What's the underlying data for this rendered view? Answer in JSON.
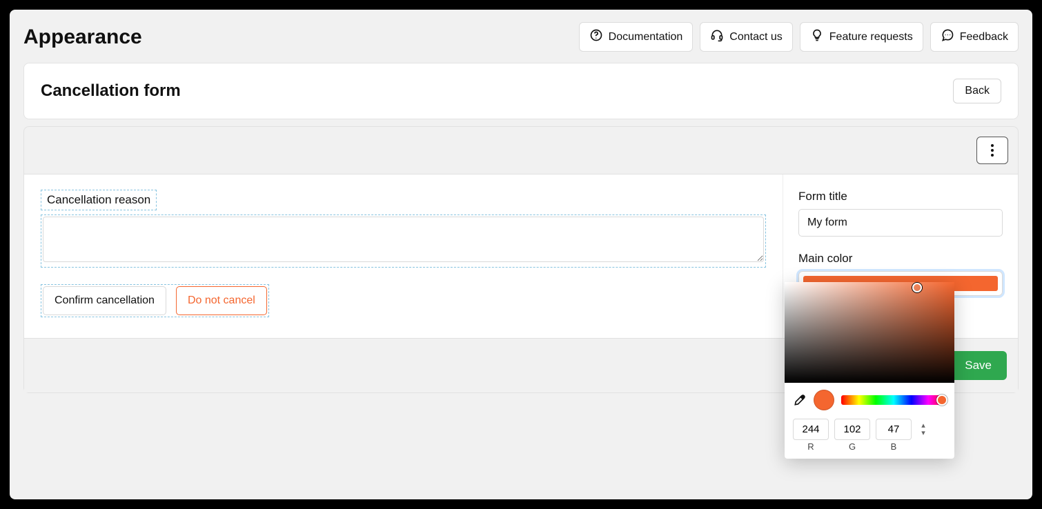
{
  "page": {
    "title": "Appearance"
  },
  "header": {
    "actions": [
      {
        "label": "Documentation",
        "icon": "help-circle-icon"
      },
      {
        "label": "Contact us",
        "icon": "headset-icon"
      },
      {
        "label": "Feature requests",
        "icon": "lightbulb-icon"
      },
      {
        "label": "Feedback",
        "icon": "chat-icon"
      }
    ]
  },
  "subheader": {
    "title": "Cancellation form",
    "back_label": "Back"
  },
  "preview": {
    "reason_label": "Cancellation reason",
    "reason_value": "",
    "confirm_label": "Confirm cancellation",
    "cancel_label": "Do not cancel"
  },
  "settings": {
    "form_title_label": "Form title",
    "form_title_value": "My form",
    "main_color_label": "Main color",
    "main_color_hex": "#f4662f"
  },
  "color_picker": {
    "r": "244",
    "g": "102",
    "b": "47",
    "r_label": "R",
    "g_label": "G",
    "b_label": "B",
    "hue_position_pct": 96
  },
  "footer": {
    "save_label": "Save"
  }
}
